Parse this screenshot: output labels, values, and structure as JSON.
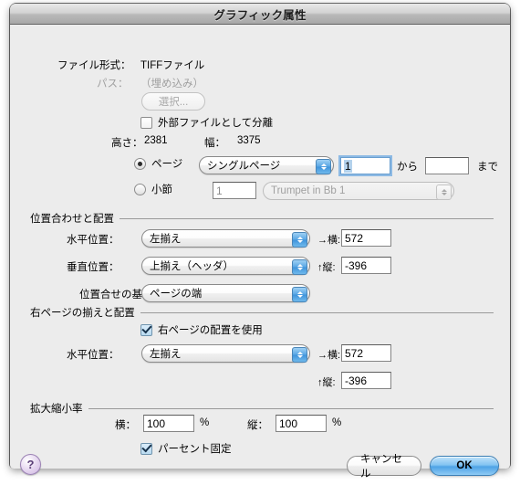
{
  "window": {
    "title": "グラフィック属性"
  },
  "info": {
    "filetype_label": "ファイル形式：",
    "filetype_value": "TIFFファイル",
    "path_label": "パス：",
    "path_value": "（埋め込み）",
    "choose_button": "選択...",
    "separate_checkbox": "外部ファイルとして分離",
    "height_label": "高さ：",
    "height_value": "2381",
    "width_label": "幅：",
    "width_value": "3375"
  },
  "range": {
    "page_radio": "ページ",
    "page_popup": "シングルページ",
    "from_value": "1",
    "from_label": "から",
    "to_value": "",
    "to_label": "まで",
    "measure_radio": "小節",
    "measure_value": "1",
    "staff_popup": "Trumpet in Bb 1"
  },
  "alignment": {
    "section_title": "位置合わせと配置",
    "horizontal_label": "水平位置：",
    "horizontal_value": "左揃え",
    "horizontal_axis": "→横:",
    "horizontal_offset": "572",
    "vertical_label": "垂直位置：",
    "vertical_value": "上揃え（ヘッダ）",
    "vertical_axis": "↑縦:",
    "vertical_offset": "-396",
    "basis_label": "位置合せの基準：",
    "basis_value": "ページの端"
  },
  "rightpage": {
    "section_title": "右ページの揃えと配置",
    "use_checkbox": "右ページの配置を使用",
    "horizontal_label": "水平位置：",
    "horizontal_value": "左揃え",
    "horizontal_axis": "→横:",
    "horizontal_offset": "572",
    "vertical_axis": "↑縦:",
    "vertical_offset": "-396"
  },
  "scale": {
    "section_title": "拡大縮小率",
    "horizontal_label": "横：",
    "horizontal_value": "100",
    "horizontal_unit": "%",
    "vertical_label": "縦：",
    "vertical_value": "100",
    "vertical_unit": "%",
    "lock_checkbox": "パーセント固定"
  },
  "footer": {
    "help": "?",
    "cancel": "キャンセル",
    "ok": "OK"
  }
}
